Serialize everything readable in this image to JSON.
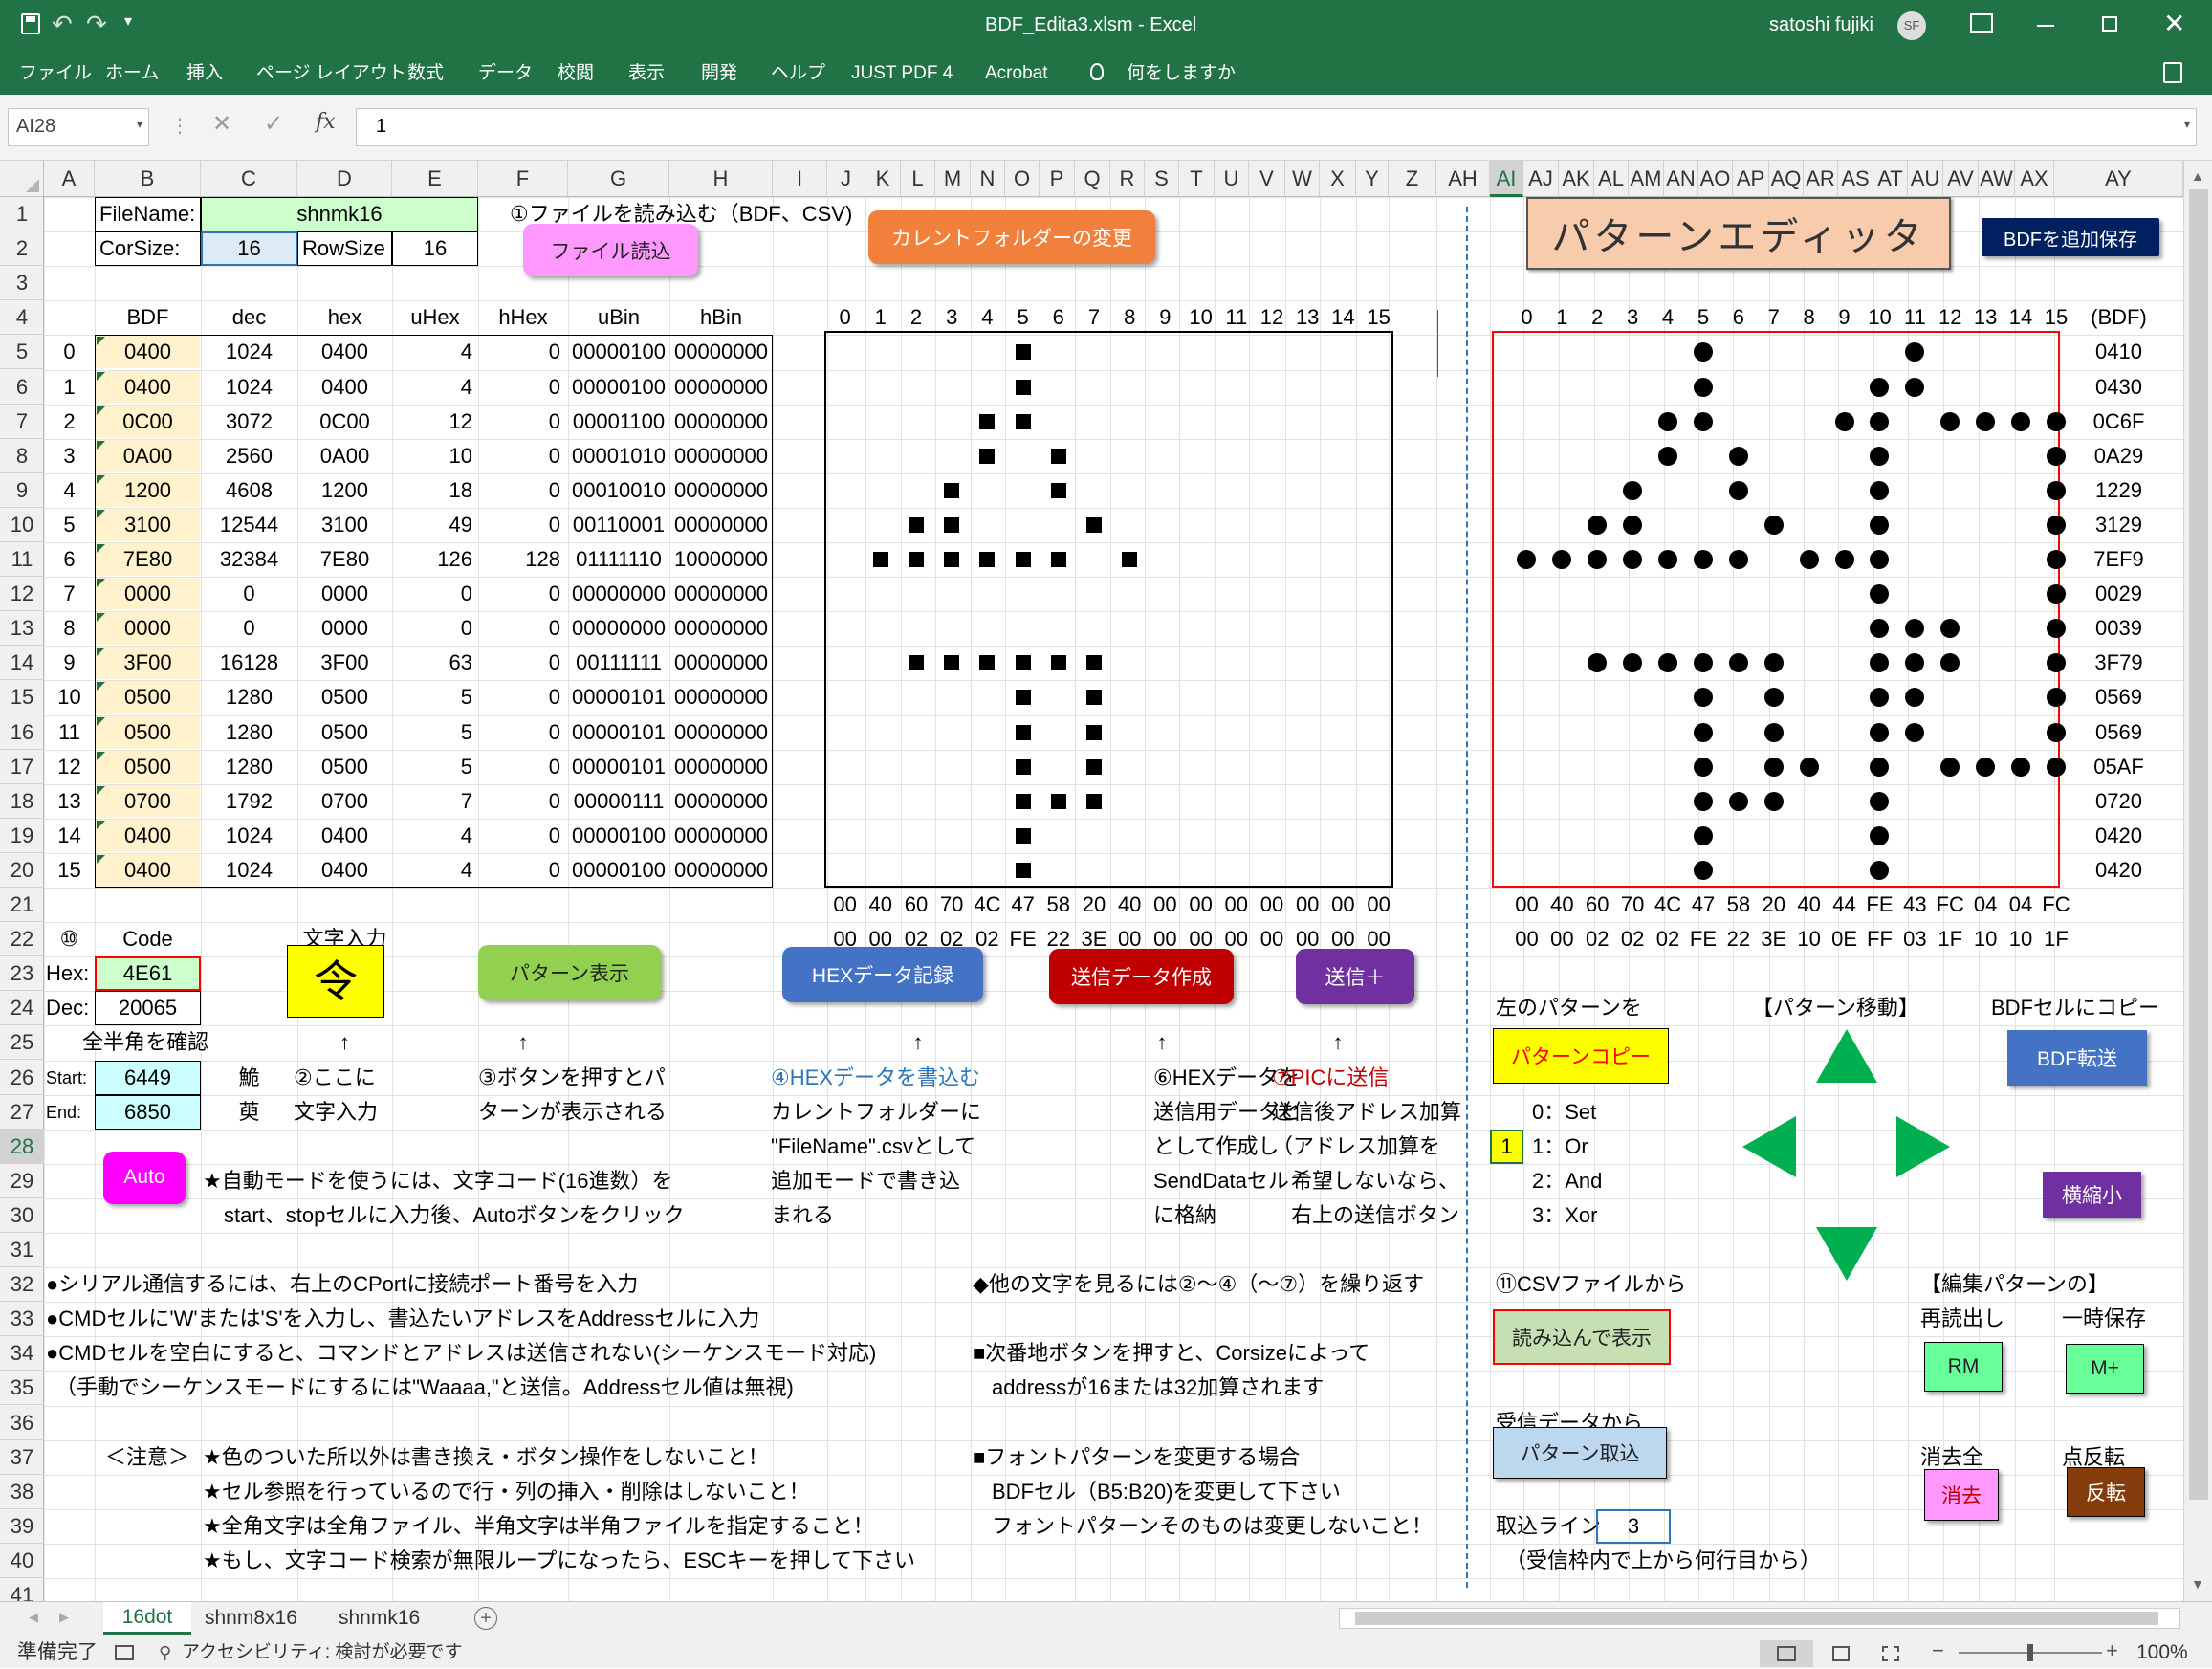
{
  "window": {
    "title": "BDF_Edita3.xlsm  -  Excel",
    "user": "satoshi fujiki",
    "user_initials": "SF"
  },
  "ribbon_tabs": [
    "ファイル",
    "ホーム",
    "挿入",
    "ページ レイアウト",
    "数式",
    "データ",
    "校閲",
    "表示",
    "開発",
    "ヘルプ",
    "JUST PDF 4",
    "Acrobat",
    "何をしますか"
  ],
  "formula_bar": {
    "name_box": "AI28",
    "value": "1",
    "fx": "fx"
  },
  "columns": [
    "A",
    "B",
    "C",
    "D",
    "E",
    "F",
    "G",
    "H",
    "I",
    "J",
    "K",
    "L",
    "M",
    "N",
    "O",
    "P",
    "Q",
    "R",
    "S",
    "T",
    "U",
    "V",
    "W",
    "X",
    "Y",
    "Z",
    "AH",
    "AI",
    "AJ",
    "AK",
    "AL",
    "AM",
    "AN",
    "AO",
    "AP",
    "AQ",
    "AR",
    "AS",
    "AT",
    "AU",
    "AV",
    "AW",
    "AX",
    "AY"
  ],
  "rows": [
    "1",
    "2",
    "3",
    "4",
    "5",
    "6",
    "7",
    "8",
    "9",
    "10",
    "11",
    "12",
    "13",
    "14",
    "15",
    "16",
    "17",
    "18",
    "19",
    "20",
    "21",
    "22",
    "23",
    "24",
    "25",
    "26",
    "27",
    "28",
    "29",
    "30",
    "31",
    "32",
    "33",
    "34",
    "35",
    "36",
    "37",
    "38",
    "39",
    "40",
    "41"
  ],
  "top": {
    "filename_label": "FileName:",
    "filename": "shnmk16",
    "corsize_label": "CorSize:",
    "corsize": "16",
    "rowsize_label": "RowSize",
    "rowsize": "16",
    "step1": "①ファイルを読み込む（BDF、CSV)"
  },
  "buttons": {
    "file_read": "ファイル読込",
    "change_folder": "カレントフォルダーの変更",
    "pattern_editor": "パターンエディッタ",
    "bdf_append": "BDFを追加保存",
    "pattern_show": "パターン表示",
    "hex_record": "HEXデータ記録",
    "send_data": "送信データ作成",
    "send_plus": "送信＋",
    "auto": "Auto",
    "pattern_copy": "パターンコピー",
    "bdf_transfer": "BDF転送",
    "shrink": "横縮小",
    "csv_load": "読み込んで表示",
    "rm": "RM",
    "mplus": "M+",
    "erase": "消去",
    "invert": "反転",
    "pattern_capture": "パターン取込"
  },
  "table": {
    "headers": [
      "BDF",
      "dec",
      "hex",
      "uHex",
      "hHex",
      "uBin",
      "hBin"
    ],
    "rows": [
      [
        "0",
        "0400",
        "1024",
        "0400",
        "4",
        "0",
        "00000100",
        "00000000"
      ],
      [
        "1",
        "0400",
        "1024",
        "0400",
        "4",
        "0",
        "00000100",
        "00000000"
      ],
      [
        "2",
        "0C00",
        "3072",
        "0C00",
        "12",
        "0",
        "00001100",
        "00000000"
      ],
      [
        "3",
        "0A00",
        "2560",
        "0A00",
        "10",
        "0",
        "00001010",
        "00000000"
      ],
      [
        "4",
        "1200",
        "4608",
        "1200",
        "18",
        "0",
        "00010010",
        "00000000"
      ],
      [
        "5",
        "3100",
        "12544",
        "3100",
        "49",
        "0",
        "00110001",
        "00000000"
      ],
      [
        "6",
        "7E80",
        "32384",
        "7E80",
        "126",
        "128",
        "01111110",
        "10000000"
      ],
      [
        "7",
        "0000",
        "0",
        "0000",
        "0",
        "0",
        "00000000",
        "00000000"
      ],
      [
        "8",
        "0000",
        "0",
        "0000",
        "0",
        "0",
        "00000000",
        "00000000"
      ],
      [
        "9",
        "3F00",
        "16128",
        "3F00",
        "63",
        "0",
        "00111111",
        "00000000"
      ],
      [
        "10",
        "0500",
        "1280",
        "0500",
        "5",
        "0",
        "00000101",
        "00000000"
      ],
      [
        "11",
        "0500",
        "1280",
        "0500",
        "5",
        "0",
        "00000101",
        "00000000"
      ],
      [
        "12",
        "0500",
        "1280",
        "0500",
        "5",
        "0",
        "00000101",
        "00000000"
      ],
      [
        "13",
        "0700",
        "1792",
        "0700",
        "7",
        "0",
        "00000111",
        "00000000"
      ],
      [
        "14",
        "0400",
        "1024",
        "0400",
        "4",
        "0",
        "00000100",
        "00000000"
      ],
      [
        "15",
        "0400",
        "1024",
        "0400",
        "4",
        "0",
        "00000100",
        "00000000"
      ]
    ]
  },
  "grid_index": [
    "0",
    "1",
    "2",
    "3",
    "4",
    "5",
    "6",
    "7",
    "8",
    "9",
    "10",
    "11",
    "12",
    "13",
    "14",
    "15"
  ],
  "bdf_label": "(BDF)",
  "left_pattern": [
    "0000010000000000",
    "0000010000000000",
    "0000110000000000",
    "0000101000000000",
    "0001001000000000",
    "0011000100000000",
    "0111111010000000",
    "0000000000000000",
    "0000000000000000",
    "0011111100000000",
    "0000010100000000",
    "0000010100000000",
    "0000010100000000",
    "0000011100000000",
    "0000010000000000",
    "0000010000000000"
  ],
  "right_pattern": [
    "0000010000010000",
    "0000010000110000",
    "0000110001101111",
    "0000101000100001",
    "0001001000100001",
    "0011000100100001",
    "1111111011100001",
    "0000000000100001",
    "0000000000111001",
    "0011111100111001",
    "0000010100110001",
    "0000010100110001",
    "0000010110101111",
    "0000011100100000",
    "0000010000100000",
    "0000010000100000"
  ],
  "right_bdf": [
    "0410",
    "0430",
    "0C6F",
    "0A29",
    "1229",
    "3129",
    "7EF9",
    "0029",
    "0039",
    "3F79",
    "0569",
    "0569",
    "05AF",
    "0720",
    "0420",
    "0420"
  ],
  "left_row21": [
    "00",
    "40",
    "60",
    "70",
    "4C",
    "47",
    "58",
    "20",
    "40",
    "00",
    "00",
    "00",
    "00",
    "00",
    "00",
    "00"
  ],
  "left_row22": [
    "00",
    "00",
    "02",
    "02",
    "02",
    "FE",
    "22",
    "3E",
    "00",
    "00",
    "00",
    "00",
    "00",
    "00",
    "00",
    "00"
  ],
  "right_row21": [
    "00",
    "40",
    "60",
    "70",
    "4C",
    "47",
    "58",
    "20",
    "40",
    "44",
    "FE",
    "43",
    "FC",
    "04",
    "04",
    "FC"
  ],
  "right_row22": [
    "00",
    "00",
    "02",
    "02",
    "02",
    "FE",
    "22",
    "3E",
    "10",
    "0E",
    "FF",
    "03",
    "1F",
    "10",
    "10",
    "1F"
  ],
  "input": {
    "num": "⑩",
    "code_label": "Code",
    "char_label": "文字入力",
    "hex_label": "Hex:",
    "hex": "4E61",
    "dec_label": "Dec:",
    "dec": "20065",
    "char": "令",
    "check_label": "全半角を確認",
    "start_label": "Start:",
    "start": "6449",
    "start_char": "鮠",
    "end_label": "End:",
    "end": "6850",
    "end_char": "萸",
    "arrow": "↑"
  },
  "notes": {
    "n2a": "②ここに",
    "n2b": "文字入力",
    "n3a": "③ボタンを押すとパ",
    "n3b": "ターンが表示される",
    "n4a": "④HEXデータを書込む",
    "n4b": "カレントフォルダーに",
    "n4c": "\"FileName\".csvとして",
    "n4d": "追加モードで書き込",
    "n4e": "まれる",
    "n6a": "⑥HEXデータを",
    "n6b": "送信用データと",
    "n6c": "として作成し",
    "n6d": "SendDataセル",
    "n6e": "に格納",
    "n7a": "⑦PICに送信",
    "n7b": "送信後アドレス加算",
    "n7c": "（アドレス加算を",
    "n7d": "希望しないなら、",
    "n7e": "右上の送信ボタン",
    "auto1": "★自動モードを使うには、文字コード(16進数）を",
    "auto2": "start、stopセルに入力後、Autoボタンをクリック",
    "s32": "●シリアル通信するには、右上のCPortに接続ポート番号を入力",
    "s32r": "◆他の文字を見るには②～④（～⑦）を繰り返す",
    "s33": "●CMDセルに'W'または'S'を入力し、書込たいアドレスをAddressセルに入力",
    "s34": "●CMDセルを空白にすると、コマンドとアドレスは送信されない(シーケンスモード対応)",
    "s34r": "■次番地ボタンを押すと、Corsizeによって",
    "s35": "（手動でシーケンスモードにするには\"Waaaa,\"と送信。Addressセル値は無視)",
    "s35r": "addressが16または32加算されます",
    "caution": "＜注意＞",
    "c1": "★色のついた所以外は書き換え・ボタン操作をしないこと！",
    "c2": "★セル参照を行っているので行・列の挿入・削除はしないこと！",
    "c3": "★全角文字は全角ファイル、半角文字は半角ファイルを指定すること！",
    "c4": "★もし、文字コード検索が無限ループになったら、ESCキーを押して下さい",
    "f1": "■フォントパターンを変更する場合",
    "f2": "BDFセル（B5:B20)を変更して下さい",
    "f3": "フォントパターンそのものは変更しないこと！"
  },
  "right": {
    "copy_label": "左のパターンを",
    "move_label": "【パターン移動】",
    "bdfcopy_label": "BDFセルにコピー",
    "mode_value": "1",
    "modes": [
      "0：Set",
      "1：Or",
      "2：And",
      "3：Xor"
    ],
    "csv_label": "⑪CSVファイルから",
    "edit_label": "【編集パターンの】",
    "reread_label": "再読出し",
    "tempsave_label": "一時保存",
    "recv_label": "受信データから",
    "erase_label": "消去全",
    "invert_label": "点反転",
    "line_label": "取込ライン",
    "line_value": "3",
    "line_note": "（受信枠内で上から何行目から）"
  },
  "sheets": [
    "16dot",
    "shnm8x16",
    "shnmk16"
  ],
  "status": {
    "ready": "準備完了",
    "accessibility": "アクセシビリティ: 検討が必要です",
    "zoom": "100%"
  },
  "colors": {
    "excel_green": "#217346",
    "input_green": "#ccffcc",
    "input_yellow": "#fff2cc",
    "input_cyan": "#ccffff",
    "red_frame": "#ff0000"
  }
}
